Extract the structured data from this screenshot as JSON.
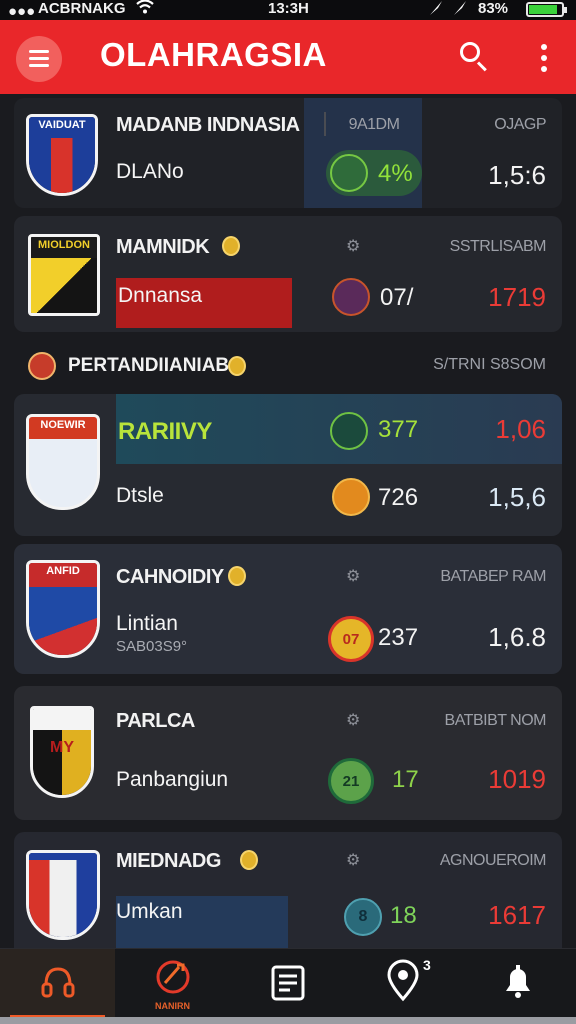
{
  "status_bar": {
    "signal": "●●●",
    "carrier": "ACBRNAKG",
    "time": "13:3H",
    "battery_pct": "83%"
  },
  "app_bar": {
    "title": "OLAHRAGSIA"
  },
  "colors": {
    "accent": "#e9272a",
    "background": "#1a1b1f",
    "card": "#25272d",
    "odds_red": "#ea3b36",
    "nav_active": "#ef5a28"
  },
  "matches_top": [
    {
      "team": "MADANB INDNASIA",
      "crest_text": "VAIDUAT",
      "meta": "9A1DM",
      "meta_right": "OJAGP",
      "opponent": "DLANo",
      "score": "4%",
      "odds": "1,5:6"
    },
    {
      "team": "MAMNIDK",
      "crest_text": "MIOLDON",
      "meta_right": "SSTRLISABM",
      "opponent": "Dnnansa",
      "score": "07/",
      "odds": "1719"
    }
  ],
  "section": {
    "title": "PERTANDIIANIAB",
    "right": "S/TRNI S8SOM"
  },
  "matches": [
    {
      "team": "RARIIVY",
      "crest_text": "NOEWIR",
      "row1_score": "377",
      "row1_odds": "1,06",
      "opponent": "Dtsle",
      "row2_score": "726",
      "row2_odds": "1,5,6"
    },
    {
      "team": "CAHNOIDIY",
      "crest_text": "ANFID",
      "meta_right": "BATABEP RAM",
      "opponent": "Lintian",
      "opponent_sub": "SAB03S9°",
      "score_icon": "07",
      "score": "237",
      "odds": "1,6.8"
    },
    {
      "team": "PARLCA",
      "crest_text": "MY",
      "meta_right": "BATBIBT NOM",
      "opponent": "Panbangiun",
      "score_icon": "21",
      "score": "17",
      "odds": "1019"
    },
    {
      "team": "MIEDNADG",
      "meta_right": "AGNOUEROIM",
      "opponent": "Umkan",
      "score_icon": "8",
      "score": "18",
      "odds": "1617"
    }
  ],
  "bottom_nav": {
    "items": [
      {
        "icon": "headset-icon"
      },
      {
        "icon": "live-score-icon",
        "label": "NANIRN"
      },
      {
        "icon": "news-icon"
      },
      {
        "icon": "location-icon",
        "badge": "3"
      },
      {
        "icon": "bell-icon"
      }
    ]
  }
}
